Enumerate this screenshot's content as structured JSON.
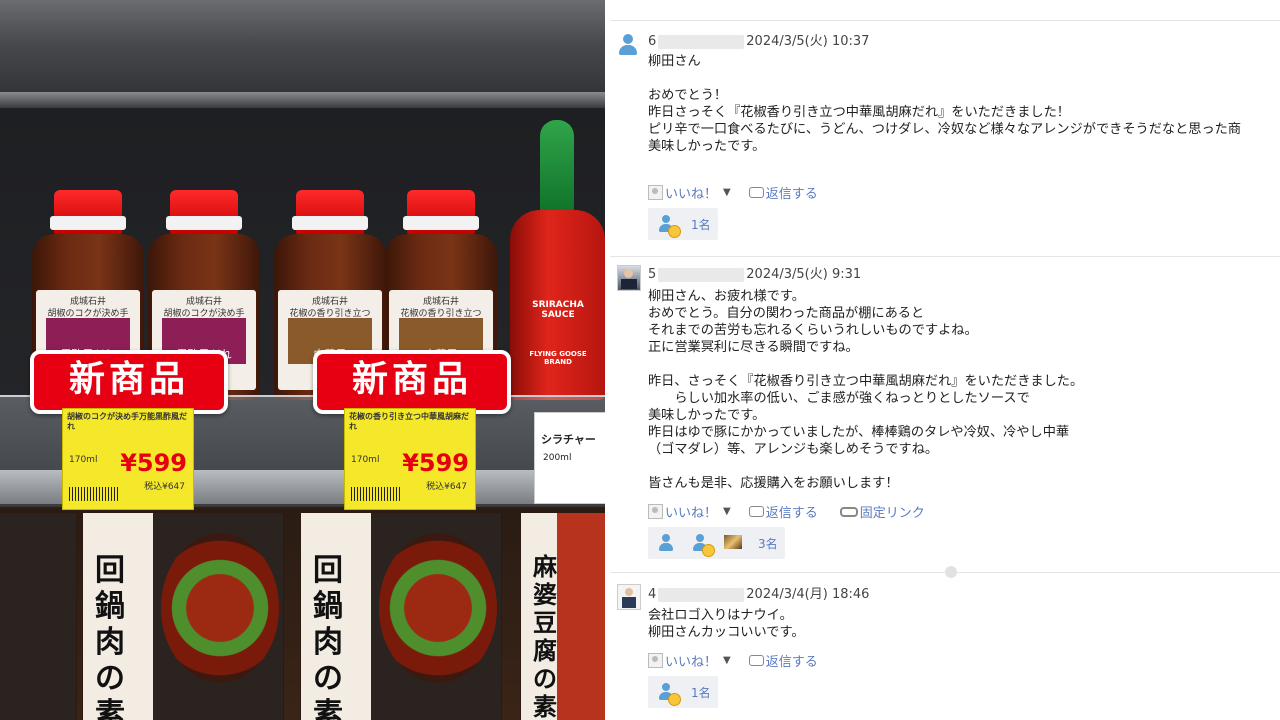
{
  "photo": {
    "badge_text": "新商品",
    "bottles": [
      {
        "label_top": "胡椒のコクが決め手",
        "label_main": "黒酢風だれ"
      },
      {
        "label_top": "胡椒のコクが決め手",
        "label_main": "黒酢風だれ"
      },
      {
        "label_top": "花椒の香り引き立つ",
        "label_main": "中華風"
      },
      {
        "label_top": "花椒の香り引き立つ",
        "label_main": "中華風"
      }
    ],
    "brand": "成城石井",
    "sriracha": {
      "name": "SRIRACHA SAUCE",
      "sub": "FLYING GOOSE BRAND"
    },
    "price_tags": [
      {
        "name": "胡椒のコクが決め手万能黒酢風だれ",
        "volume": "170ml",
        "price": "¥599",
        "tax": "税込¥647"
      },
      {
        "name": "花椒の香り引き立つ中華風胡麻だれ",
        "volume": "170ml",
        "price": "¥599",
        "tax": "税込¥647"
      }
    ],
    "sriracha_tag": {
      "name": "シラチャー",
      "volume": "200ml"
    },
    "boxes": [
      {
        "title": "回鍋肉の素"
      },
      {
        "title": "回鍋肉の素"
      },
      {
        "title": "麻婆豆腐の素"
      }
    ]
  },
  "comments": [
    {
      "number": "6",
      "date": "2024/3/5(火) 10:37",
      "body": "柳田さん\n\nおめでとう！\n昨日さっそく『花椒香り引き立つ中華風胡麻だれ』をいただきました！\nピリ辛で一口食べるたびに、うどん、つけダレ、冷奴など様々なアレンジができそうだなと思った商\n美味しかったです。",
      "like_label": "いいね！",
      "reply_label": "返信する",
      "likes_count": "1名"
    },
    {
      "number": "5",
      "date": "2024/3/5(火) 9:31",
      "body": "柳田さん、お疲れ様です。\nおめでとう。自分の関わった商品が棚にあると\nそれまでの苦労も忘れるくらいうれしいものですよね。\n正に営業冥利に尽きる瞬間ですね。\n\n昨日、さっそく『花椒香り引き立つ中華風胡麻だれ』をいただきました。\n　　らしい加水率の低い、ごま感が強くねっとりとしたソースで\n美味しかったです。\n昨日はゆで豚にかかっていましたが、棒棒鶏のタレや冷奴、冷やし中華\n（ゴマダレ）等、アレンジも楽しめそうですね。\n\n皆さんも是非、応援購入をお願いします！",
      "like_label": "いいね！",
      "reply_label": "返信する",
      "permalink_label": "固定リンク",
      "likes_count": "3名"
    },
    {
      "number": "4",
      "date": "2024/3/4(月) 18:46",
      "body": "会社ロゴ入りはナウイ。\n柳田さんカッコいいです。",
      "like_label": "いいね！",
      "reply_label": "返信する",
      "likes_count": "1名"
    }
  ],
  "colors": {
    "link": "#5b7bbf",
    "badge_red": "#e60012",
    "tag_yellow": "#f5e82a"
  }
}
